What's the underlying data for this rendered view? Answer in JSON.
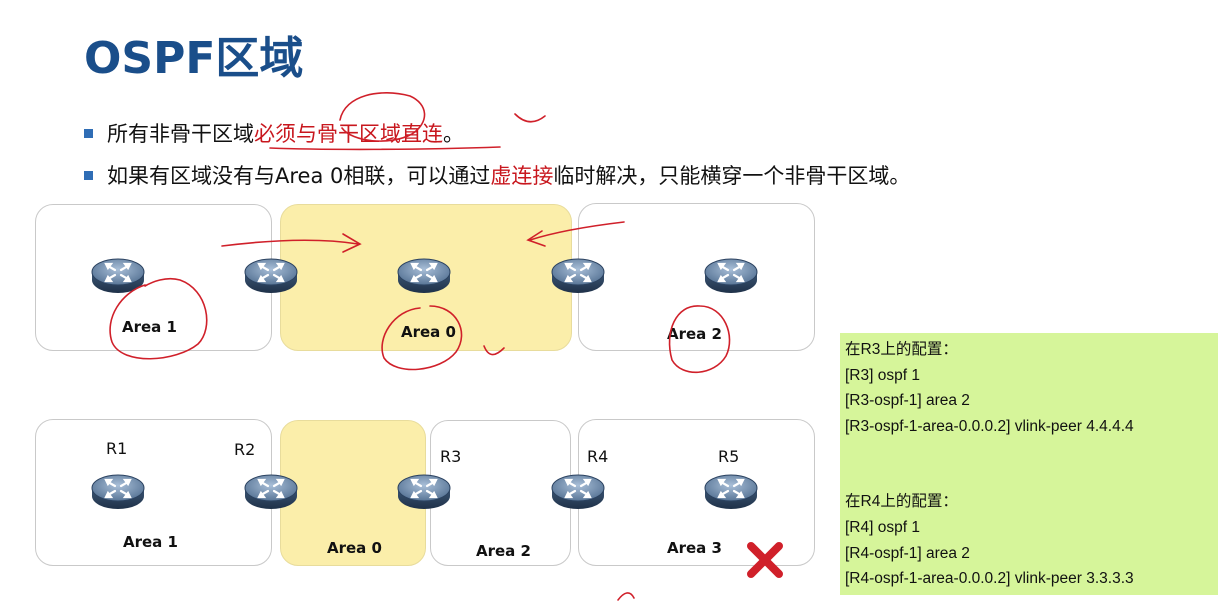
{
  "title": "OSPF区域",
  "bullets": [
    {
      "prefix": "所有非骨干区域",
      "highlight": "必须与骨干区域直连",
      "suffix": "。"
    },
    {
      "prefix": "如果有区域没有与Area 0相联，可以通过",
      "highlight": "虚连接",
      "suffix": "临时解决，只能横穿一个非骨干区域。"
    }
  ],
  "diagram_top": {
    "areas": [
      "Area 1",
      "Area 0",
      "Area 2"
    ]
  },
  "diagram_bottom": {
    "areas": [
      "Area 1",
      "Area 0",
      "Area 2",
      "Area 3"
    ],
    "routers": [
      "R1",
      "R2",
      "R3",
      "R4",
      "R5"
    ]
  },
  "config": {
    "r3_heading": "在R3上的配置：",
    "r3_lines": [
      "[R3] ospf 1",
      "[R3-ospf-1] area 2",
      "[R3-ospf-1-area-0.0.0.2] vlink-peer 4.4.4.4"
    ],
    "r4_heading": "在R4上的配置：",
    "r4_lines": [
      "[R4] ospf 1",
      "[R4-ospf-1] area 2",
      "[R4-ospf-1-area-0.0.0.2] vlink-peer 3.3.3.3"
    ]
  },
  "icons": {
    "router": "router-icon",
    "fail": "cross-icon"
  },
  "colors": {
    "title": "#1a4e8a",
    "highlight": "#c8171e",
    "backbone": "#fbeeaa",
    "config_bg": "#d6f59a",
    "annotation": "#d0202a",
    "fail": "#d0202a"
  }
}
